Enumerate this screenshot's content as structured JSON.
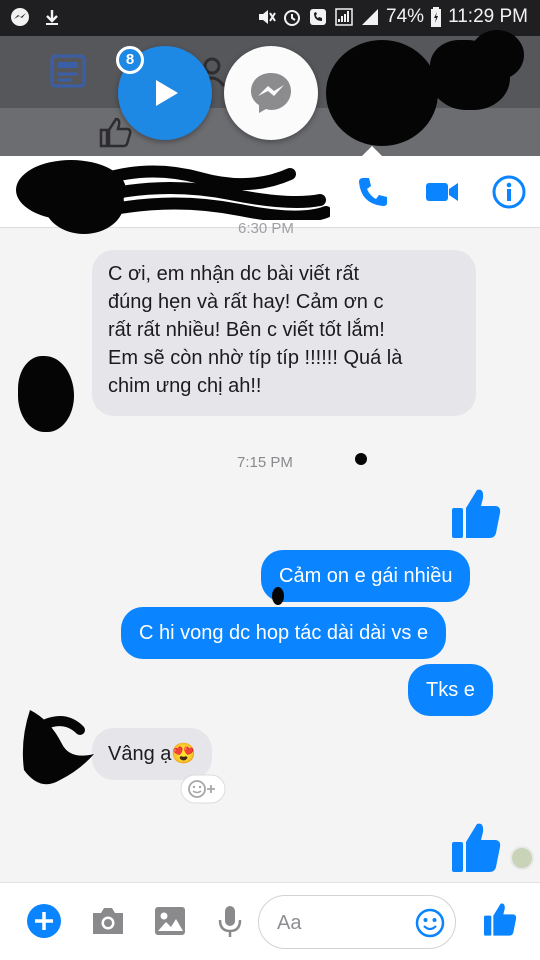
{
  "status_bar": {
    "battery": "74%",
    "time": "11:29 PM"
  },
  "chat_heads": {
    "unread_badge": "8"
  },
  "messages": {
    "timestamp_top": "6:30 PM",
    "incoming_long": [
      "C ơi, em nhận dc bài viết rất",
      "đúng hẹn và rất hay! Cảm ơn c",
      "rất rất nhiều! Bên c viết tốt lắm!",
      "Em sẽ còn nhờ típ típ !!!!!! Quá là",
      "chim ưng chị ah!!"
    ],
    "timestamp_mid": "7:15 PM",
    "outgoing_1": "Cảm on e gái nhiều",
    "outgoing_2": "C hi vong dc hop tác dài dài vs e",
    "outgoing_3": "Tks e",
    "incoming_short": "Vâng ạ😍"
  },
  "composer": {
    "placeholder": "Aa"
  },
  "colors": {
    "messenger_blue": "#0a84ff",
    "incoming_bubble": "#e5e5ea",
    "status_bar": "#1f1f22"
  },
  "icons": [
    "download-icon",
    "messenger-notification-icon",
    "mute-icon",
    "alarm-icon",
    "phone-icon",
    "video-icon",
    "info-icon",
    "thumbs-up-icon",
    "add-icon",
    "camera-icon",
    "gallery-icon",
    "microphone-icon",
    "emoji-icon",
    "add-reaction-icon"
  ]
}
